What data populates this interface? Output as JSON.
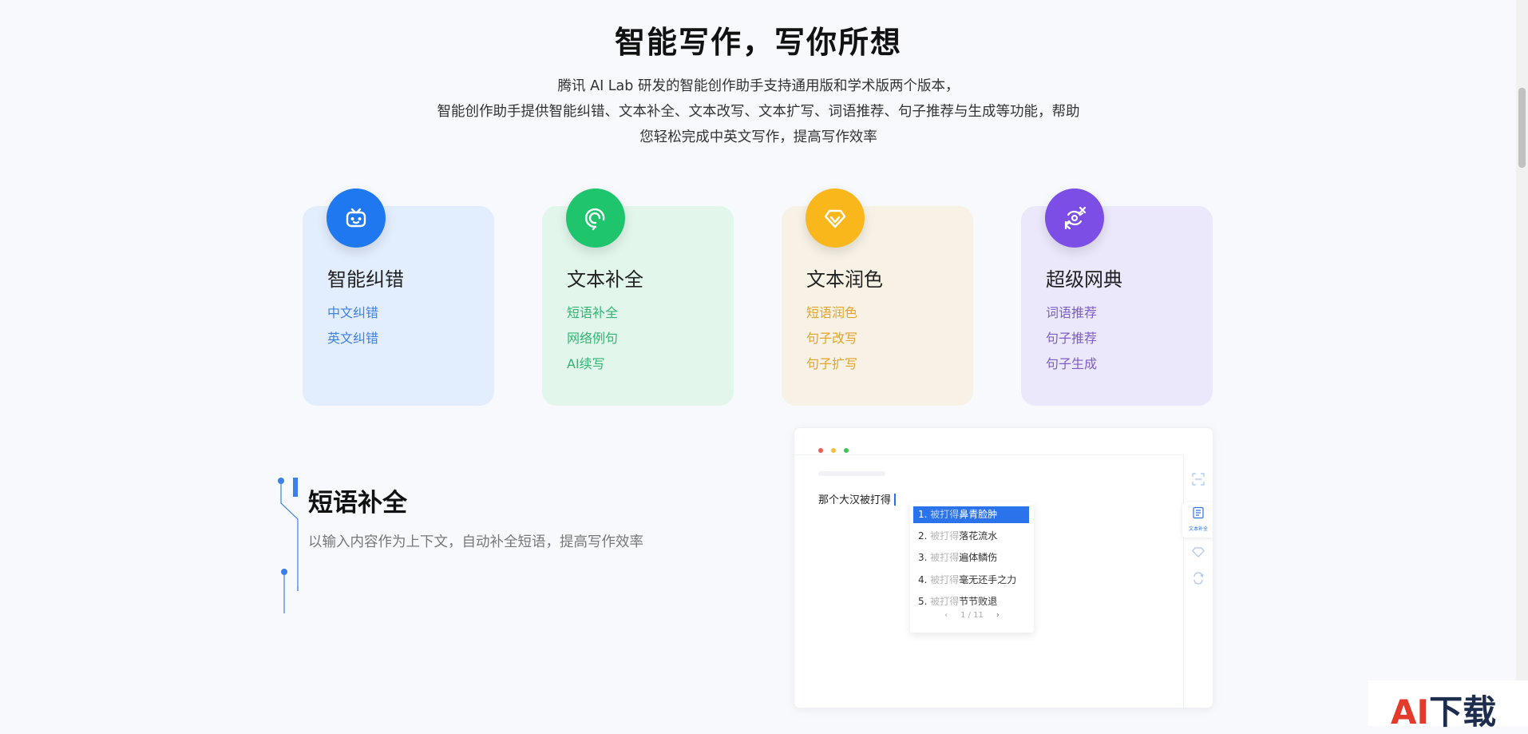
{
  "hero": {
    "title": "智能写作，写你所想",
    "desc_lines": [
      "腾讯 AI Lab 研发的智能创作助手支持通用版和学术版两个版本，",
      "智能创作助手提供智能纠错、文本补全、文本改写、文本扩写、词语推荐、句子推荐与生成等功能，帮助",
      "您轻松完成中英文写作，提高写作效率"
    ]
  },
  "features": [
    {
      "title": "智能纠错",
      "icon": "robot-icon",
      "bg": "#e2edfd",
      "accent": "#1f78f0",
      "text_color": "#3d82e6",
      "items": [
        "中文纠错",
        "英文纠错"
      ]
    },
    {
      "title": "文本补全",
      "icon": "bulb-icon",
      "bg": "#e2f6ec",
      "accent": "#1ec56d",
      "text_color": "#31b673",
      "items": [
        "短语补全",
        "网络例句",
        "AI续写"
      ]
    },
    {
      "title": "文本润色",
      "icon": "diamond-icon",
      "bg": "#f7f2e5",
      "accent": "#f9b71b",
      "text_color": "#e6a328",
      "items": [
        "短语润色",
        "句子改写",
        "句子扩写"
      ]
    },
    {
      "title": "超级网典",
      "icon": "dictionary-icon",
      "bg": "#ebe8fc",
      "accent": "#7c4ee6",
      "text_color": "#7d5ec5",
      "items": [
        "词语推荐",
        "句子推荐",
        "句子生成"
      ]
    }
  ],
  "section": {
    "title": "短语补全",
    "desc": "以输入内容作为上下文，自动补全短语，提高写作效率"
  },
  "demo": {
    "typed_text": "那个大汉被打得",
    "suggestions": [
      {
        "num": "1.",
        "prefix": "被打得",
        "text": "鼻青脸肿",
        "selected": true
      },
      {
        "num": "2.",
        "prefix": "被打得",
        "text": "落花流水",
        "selected": false
      },
      {
        "num": "3.",
        "prefix": "被打得",
        "text": "遍体鳞伤",
        "selected": false
      },
      {
        "num": "4.",
        "prefix": "被打得",
        "text": "毫无还手之力",
        "selected": false
      },
      {
        "num": "5.",
        "prefix": "被打得",
        "text": "节节败退",
        "selected": false
      }
    ],
    "pager": "1 / 11",
    "active_tool_label": "文本补全"
  },
  "watermark": {
    "text": "AI下载",
    "brand_red": "#e43a2c",
    "brand_dark": "#1c2d4d"
  }
}
